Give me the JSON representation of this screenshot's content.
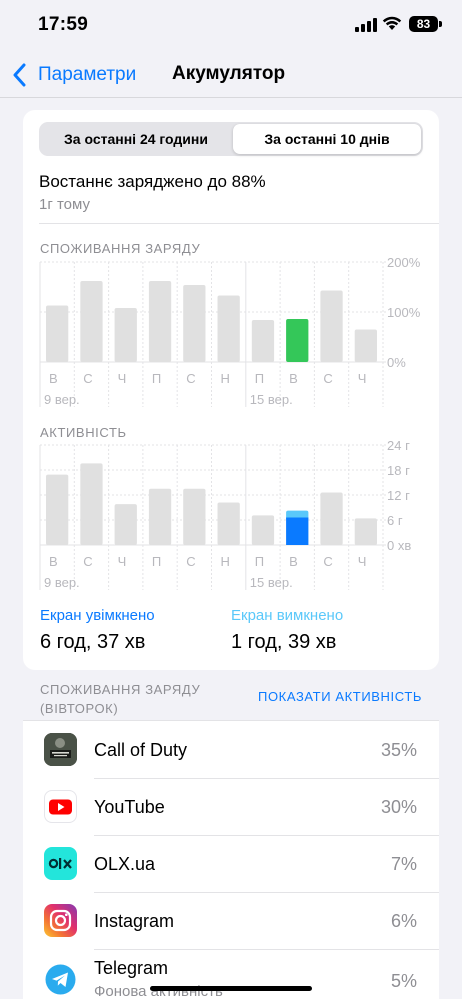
{
  "status_bar": {
    "time": "17:59",
    "battery": "83"
  },
  "nav": {
    "back_label": "Параметри",
    "title": "Акумулятор"
  },
  "segment": {
    "left": "За останні 24 години",
    "right": "За останні 10 днів",
    "selected": "right"
  },
  "last_charge": {
    "text": "Востаннє заряджено до 88%",
    "ago": "1г тому"
  },
  "usage_chart": {
    "label": "СПОЖИВАННЯ ЗАРЯДУ",
    "y_ticks": [
      "200%",
      "100%",
      "0%"
    ]
  },
  "activity_chart": {
    "label": "АКТИВНІСТЬ",
    "y_ticks": [
      "24 г",
      "18 г",
      "12 г",
      "6 г",
      "0 хв"
    ]
  },
  "days": [
    "В",
    "С",
    "Ч",
    "П",
    "С",
    "Н",
    "П",
    "В",
    "С",
    "Ч"
  ],
  "date_labels": [
    "9 вер.",
    "15 вер."
  ],
  "colors": {
    "accent": "#0a7aff",
    "bar_gray": "#e0e0e0",
    "usage_highlight": "#34c759",
    "screen_on": "#0a7aff",
    "screen_off": "#5ac8fa"
  },
  "chart_data": [
    {
      "type": "bar",
      "title": "СПОЖИВАННЯ ЗАРЯДУ",
      "categories": [
        "В",
        "С",
        "Ч",
        "П",
        "С",
        "Н",
        "П",
        "В",
        "С",
        "Ч"
      ],
      "values": [
        113,
        162,
        108,
        162,
        154,
        133,
        84,
        86,
        143,
        65
      ],
      "highlight_index": 7,
      "ylim": [
        0,
        200
      ],
      "ylabel": "",
      "xlabel": "",
      "grid": true
    },
    {
      "type": "bar",
      "title": "АКТИВНІСТЬ",
      "categories": [
        "В",
        "С",
        "Ч",
        "П",
        "С",
        "Н",
        "П",
        "В",
        "С",
        "Ч"
      ],
      "series": [
        {
          "name": "Екран увімкнено",
          "values": [
            0,
            0,
            0,
            0,
            0,
            0,
            0,
            6.6,
            0,
            0
          ]
        },
        {
          "name": "Екран вимкнено",
          "values": [
            0,
            0,
            0,
            0,
            0,
            0,
            0,
            1.65,
            0,
            0
          ]
        },
        {
          "values": [
            16.9,
            19.6,
            9.8,
            13.5,
            13.5,
            10.2,
            7.1,
            0,
            12.6,
            6.4
          ]
        }
      ],
      "highlight_index": 7,
      "ylim": [
        0,
        24
      ],
      "ylabel": "",
      "xlabel": "",
      "grid": true
    }
  ],
  "screen_on": {
    "title": "Екран увімкнено",
    "value": "6 год, 37 хв"
  },
  "screen_off": {
    "title": "Екран вимкнено",
    "value": "1 год, 39 хв"
  },
  "usage_section": {
    "title": "СПОЖИВАННЯ ЗАРЯДУ (ВІВТОРОК)",
    "show_activity": "ПОКАЗАТИ АКТИВНІСТЬ"
  },
  "apps": [
    {
      "name": "Call of Duty",
      "percent": "35%",
      "icon": "call-of-duty-icon"
    },
    {
      "name": "YouTube",
      "percent": "30%",
      "icon": "youtube-icon"
    },
    {
      "name": "OLX.ua",
      "percent": "7%",
      "icon": "olx-icon"
    },
    {
      "name": "Instagram",
      "percent": "6%",
      "icon": "instagram-icon"
    },
    {
      "name": "Telegram",
      "subtitle": "Фонова активність",
      "percent": "5%",
      "icon": "telegram-icon"
    }
  ]
}
